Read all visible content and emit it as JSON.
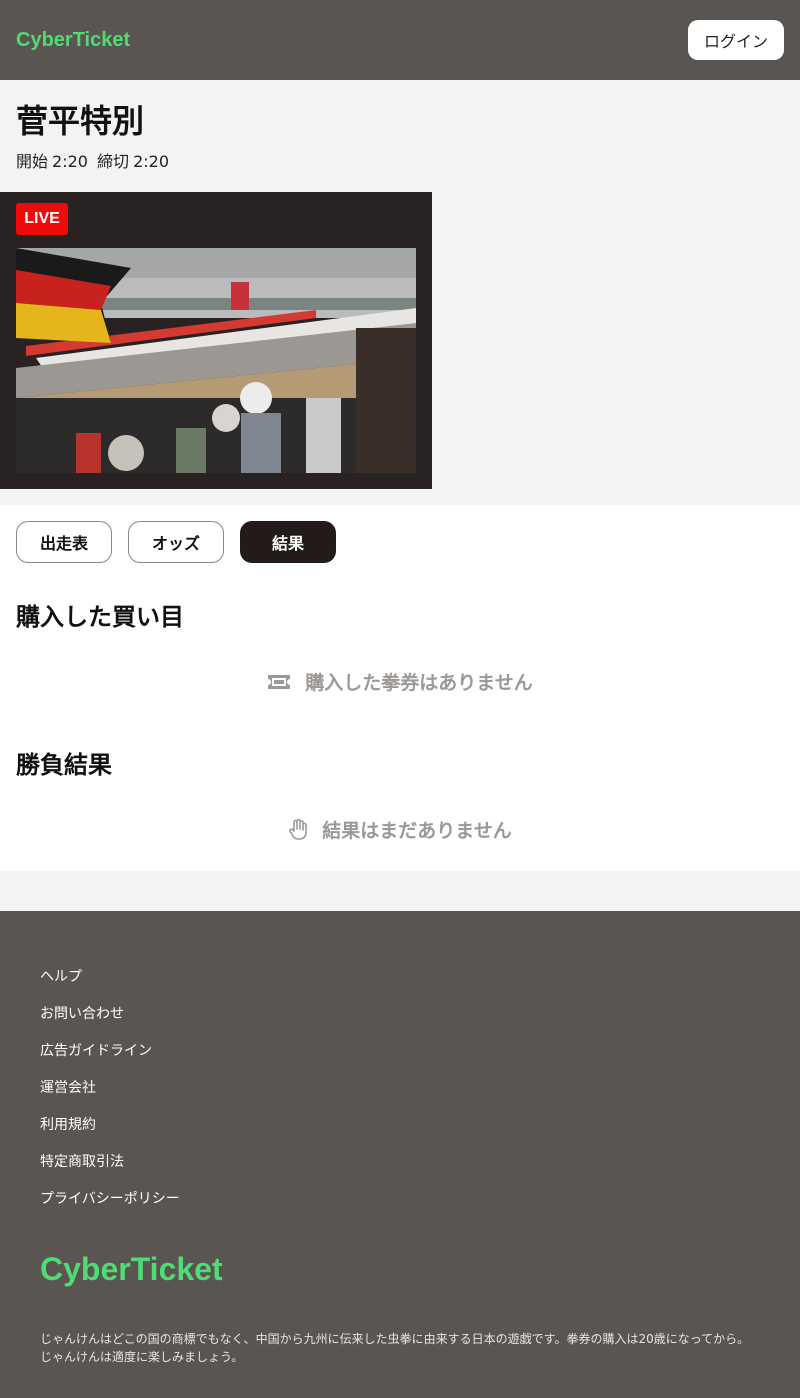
{
  "header": {
    "brand": "CyberTicket",
    "login_label": "ログイン"
  },
  "race": {
    "title": "菅平特別",
    "start_label": "開始",
    "start_time": "2:20",
    "close_label": "締切",
    "close_time": "2:20"
  },
  "live": {
    "badge": "LIVE"
  },
  "tabs": [
    {
      "label": "出走表",
      "active": false
    },
    {
      "label": "オッズ",
      "active": false
    },
    {
      "label": "結果",
      "active": true
    }
  ],
  "purchases": {
    "title": "購入した買い目",
    "empty_icon": "ticket-icon",
    "empty_text": "購入した拳券はありません"
  },
  "results": {
    "title": "勝負結果",
    "empty_icon": "hand-icon",
    "empty_text": "結果はまだありません"
  },
  "footer": {
    "links": [
      "ヘルプ",
      "お問い合わせ",
      "広告ガイドライン",
      "運営会社",
      "利用規約",
      "特定商取引法",
      "プライバシーポリシー"
    ],
    "brand": "CyberTicket",
    "note": "じゃんけんはどこの国の商標でもなく、中国から九州に伝来した虫拳に由来する日本の遊戯です。拳券の購入は20歳になってから。じゃんけんは適度に楽しみましょう。"
  },
  "colors": {
    "brand_green": "#4fdc74",
    "header_bg": "#5a5551",
    "live_red": "#ee0b0b",
    "active_tab_bg": "#221b19"
  }
}
